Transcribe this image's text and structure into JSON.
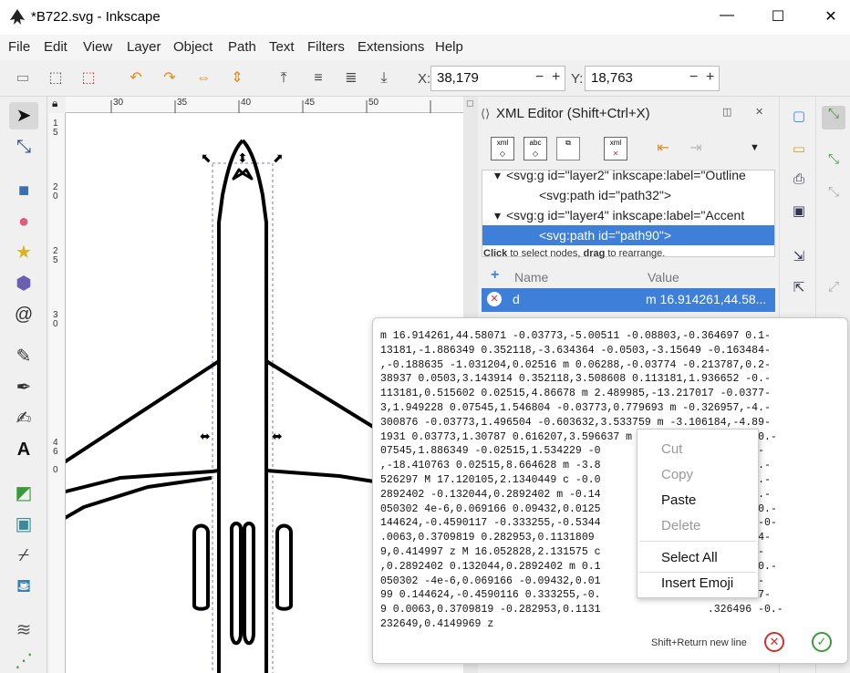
{
  "window": {
    "title": "*B722.svg - Inkscape",
    "controls": [
      "—",
      "☐",
      "✕"
    ]
  },
  "menu": [
    "File",
    "Edit",
    "View",
    "Layer",
    "Object",
    "Path",
    "Text",
    "Filters",
    "Extensions",
    "Help"
  ],
  "toolbar": {
    "x_label": "X:",
    "x_value": "38,179",
    "y_label": "Y:",
    "y_value": "18,763"
  },
  "ruler": {
    "h_labels": [
      "30",
      "35",
      "40",
      "45",
      "50"
    ],
    "v_labels": [
      "1",
      "5",
      "2",
      "0",
      "2",
      "5",
      "3",
      "0",
      "4",
      "6",
      "0"
    ]
  },
  "xml_editor": {
    "title": "XML Editor (Shift+Ctrl+X)",
    "buttons": [
      "xml",
      "abc",
      "dup",
      "del",
      "unindent",
      "indent"
    ],
    "tree": [
      {
        "text": "<svg:g id=\"layer2\" inkscape:label=\"Outline",
        "indent": 1,
        "expander": "▾",
        "selected": false
      },
      {
        "text": "<svg:path id=\"path32\">",
        "indent": 2,
        "expander": "",
        "selected": false
      },
      {
        "text": "<svg:g id=\"layer4\" inkscape:label=\"Accent",
        "indent": 1,
        "expander": "▾",
        "selected": false
      },
      {
        "text": "<svg:path id=\"path90\">",
        "indent": 2,
        "expander": "",
        "selected": true
      }
    ],
    "hint_bold1": "Click",
    "hint_mid": " to select nodes, ",
    "hint_bold2": "drag",
    "hint_end": " to rearrange.",
    "attr_col_name": "Name",
    "attr_col_value": "Value",
    "attr_name": "d",
    "attr_value": "m 16.914261,44.58..."
  },
  "popover": {
    "path_text": "m 16.914261,44.58071 -0.03773,-5.00511 -0.08803,-0.364697 0.1-\n13181,-1.886349 0.352118,-3.634364 -0.0503,-3.15649 -0.163484-\n,-0.188635 -1.031204,0.02516 m 0.06288,-0.03774 -0.213787,0.2-\n38937 0.0503,3.143914 0.352118,3.508608 0.113181,1.936652 -0.-\n113181,0.515602 0.02515,4.86678 m 2.489985,-13.217017 -0.0377-\n3,1.949228 0.07545,1.546804 -0.03773,0.779693 m -0.326957,-4.-\n300876 -0.03773,1.496504 -0.603632,3.533759 m -3.106184,-4.89-\n1931 0.03773,1.30787 0.616207,3.596637 m -0.99348,-4.979961 0.-\n07545,1.886349 -0.02515,1.534229 -0                 4.187696-\n,-18.410763 0.02515,8.664628 m -3.8                 .02515,8.-\n526297 M 17.120105,2.1340449 c -0.0                 132044,0.-\n2892402 -0.132044,0.2892402 m -0.14                 09432,-0.-\n050302 4e-6,0.069166 0.09432,0.0125                 .37727 -0.-\n144624,-0.4590117 -0.333255,-0.5344                 1509079 -0-\n.0063,0.3709819 0.282953,0.1131809                  6 0.23264-\n9,0.414997 z M 16.052828,2.131575 c                 0.132044-\n,0.2892402 0.132044,0.2892402 m 0.1                 .09432,-0.-\n050302 -4e-6,0.069166 -0.09432,0.01                 ,0.37726-\n99 0.144624,-0.4590116 0.333255,-0.                 -0.150907-\n9 0.0063,0.3709819 -0.282953,0.1131                 .326496 -0.-\n232649,0.4149969 z",
    "footer_hint": "Shift+Return new line"
  },
  "context_menu": {
    "items": [
      {
        "label": "Cut",
        "enabled": false
      },
      {
        "label": "Copy",
        "enabled": false
      },
      {
        "label": "Paste",
        "enabled": true
      },
      {
        "label": "Delete",
        "enabled": false
      },
      {
        "label": "Select All",
        "enabled": true
      },
      {
        "label": "Insert Emoji",
        "enabled": true
      }
    ]
  },
  "colors": {
    "selection": "#3d7fd9",
    "accent_orange": "#e58a1f",
    "cancel_red": "#d03030",
    "ok_green": "#3a9a3a"
  }
}
